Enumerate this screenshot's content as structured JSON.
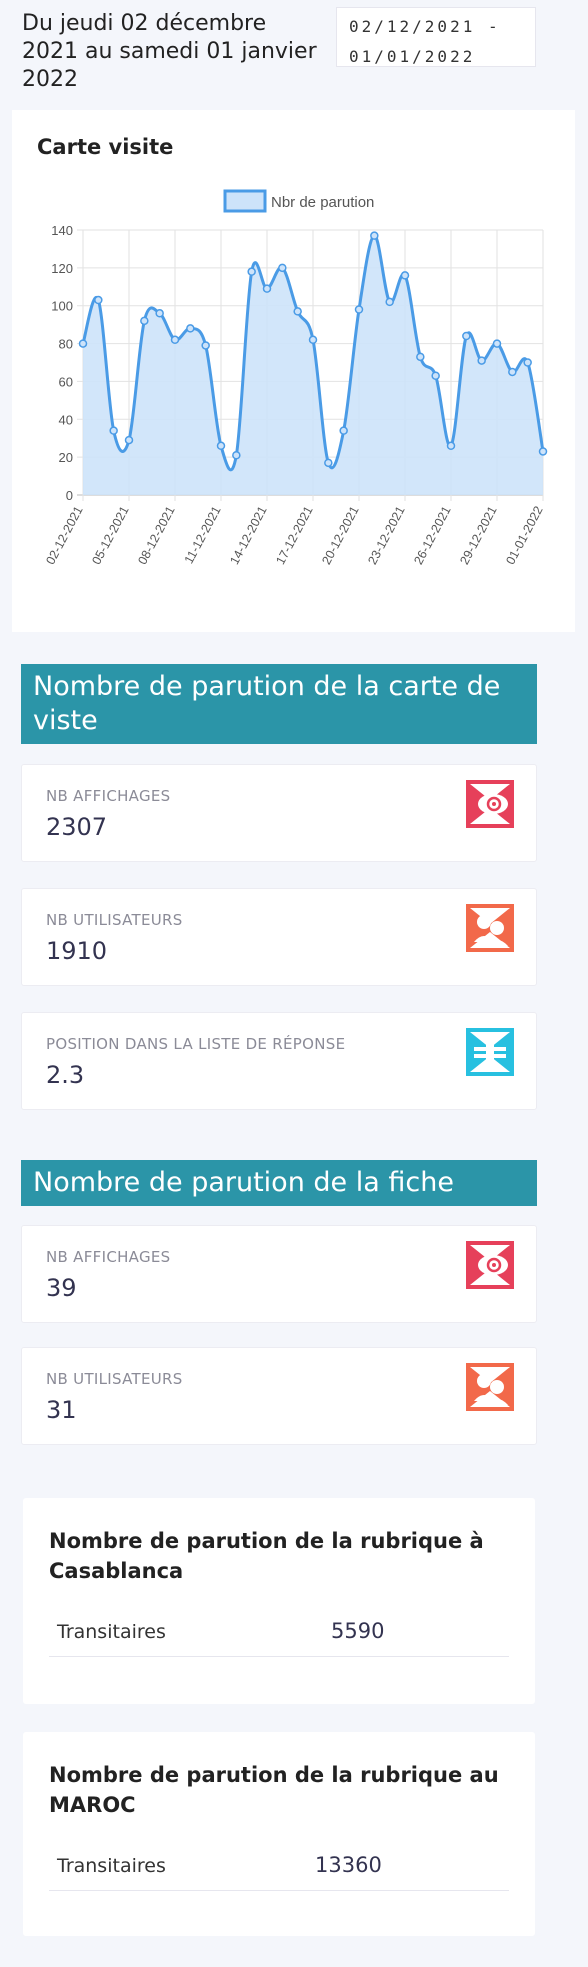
{
  "header": {
    "date_text": "Du jeudi 02 décembre 2021 au samedi 01 janvier 2022",
    "range_value": "02/12/2021 -\n01/01/2022"
  },
  "chart": {
    "title": "Carte visite"
  },
  "chart_data": {
    "type": "line",
    "legend": "Nbr de parution",
    "x": [
      "02-12-2021",
      "03-12-2021",
      "04-12-2021",
      "05-12-2021",
      "06-12-2021",
      "07-12-2021",
      "08-12-2021",
      "09-12-2021",
      "10-12-2021",
      "11-12-2021",
      "12-12-2021",
      "13-12-2021",
      "14-12-2021",
      "15-12-2021",
      "16-12-2021",
      "17-12-2021",
      "18-12-2021",
      "19-12-2021",
      "20-12-2021",
      "21-12-2021",
      "22-12-2021",
      "23-12-2021",
      "24-12-2021",
      "25-12-2021",
      "26-12-2021",
      "27-12-2021",
      "28-12-2021",
      "29-12-2021",
      "30-12-2021",
      "31-12-2021",
      "01-01-2022"
    ],
    "tick_labels": [
      "02-12-2021",
      "05-12-2021",
      "08-12-2021",
      "11-12-2021",
      "14-12-2021",
      "17-12-2021",
      "20-12-2021",
      "23-12-2021",
      "26-12-2021",
      "29-12-2021",
      "01-01-2022"
    ],
    "values": [
      80,
      103,
      34,
      29,
      92,
      96,
      82,
      88,
      79,
      26,
      21,
      118,
      109,
      120,
      97,
      82,
      17,
      34,
      98,
      137,
      102,
      116,
      73,
      63,
      26,
      84,
      71,
      80,
      65,
      70,
      23
    ],
    "ylim": [
      0,
      140
    ],
    "yticks": [
      0,
      20,
      40,
      60,
      80,
      100,
      120,
      140
    ],
    "grid": true,
    "legend_position": "top-center",
    "colors": {
      "line": "#4a9be6",
      "fill": "#cde3fa"
    }
  },
  "section_carte": {
    "title": "Nombre de parution de la carte de viste",
    "stats": [
      {
        "label": "NB AFFICHAGES",
        "value": "2307",
        "icon": "eye-icon",
        "color": "#e6405a"
      },
      {
        "label": "NB UTILISATEURS",
        "value": "1910",
        "icon": "users-icon",
        "color": "#f2694a"
      },
      {
        "label": "POSITION DANS LA LISTE DE RÉPONSE",
        "value": "2.3",
        "icon": "list-position-icon",
        "color": "#27c0e0"
      }
    ]
  },
  "section_fiche": {
    "title": "Nombre de parution de la fiche",
    "stats": [
      {
        "label": "NB AFFICHAGES",
        "value": "39",
        "icon": "eye-icon",
        "color": "#e6405a"
      },
      {
        "label": "NB UTILISATEURS",
        "value": "31",
        "icon": "users-icon",
        "color": "#f2694a"
      }
    ]
  },
  "rubrique_casablanca": {
    "title": "Nombre de parution de la rubrique à Casablanca",
    "row": {
      "name": "Transitaires",
      "value": "5590"
    }
  },
  "rubrique_maroc": {
    "title": "Nombre de parution de la rubrique au MAROC",
    "row": {
      "name": "Transitaires",
      "value": "13360"
    }
  }
}
